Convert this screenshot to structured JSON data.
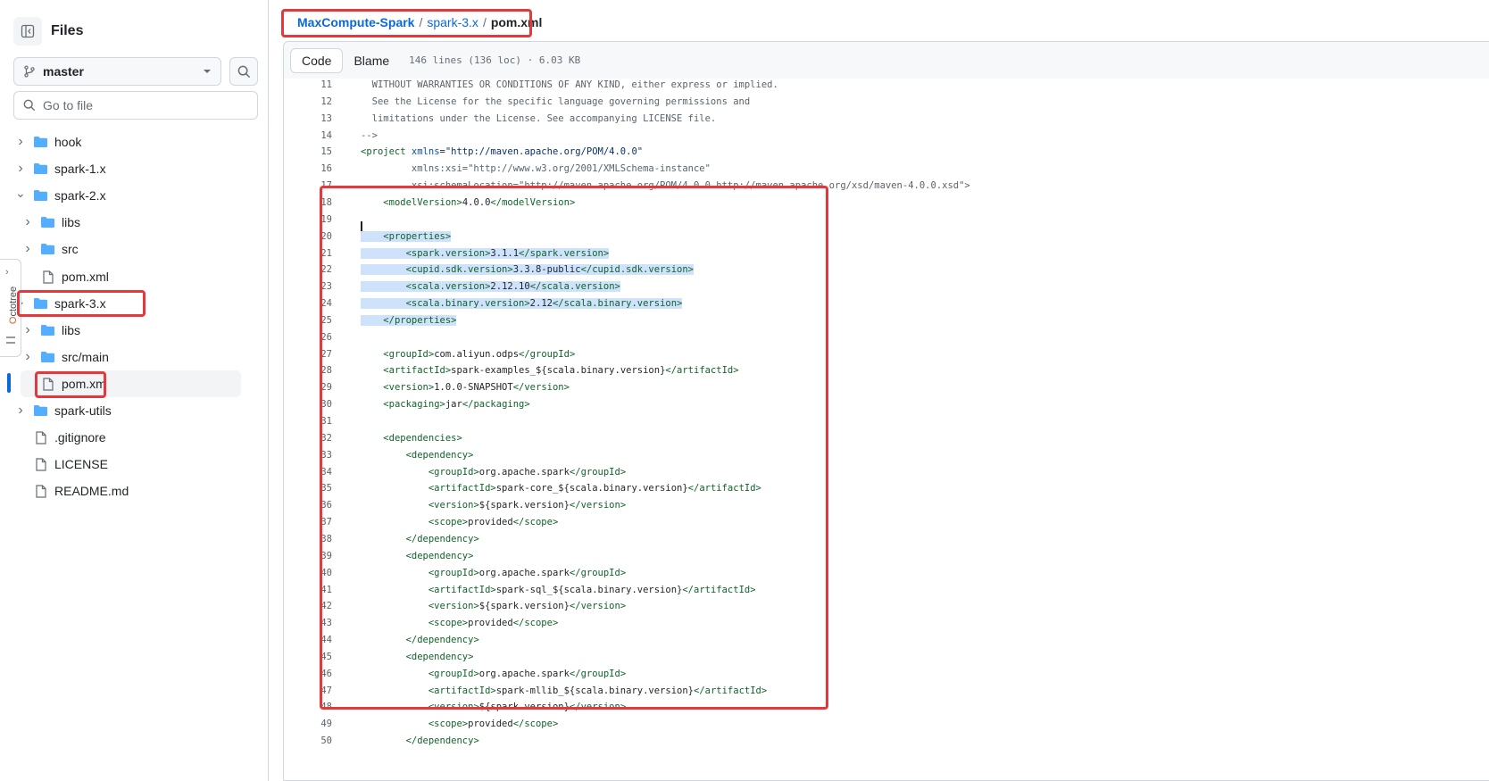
{
  "sidebar": {
    "title": "Files",
    "branch": "master",
    "goto_placeholder": "Go to file",
    "octotree_label": "Octotree",
    "tree": [
      {
        "name": "hook",
        "type": "folder",
        "chevron": "›",
        "depth": 0
      },
      {
        "name": "spark-1.x",
        "type": "folder",
        "chevron": "›",
        "depth": 0
      },
      {
        "name": "spark-2.x",
        "type": "folder",
        "chevron": "⌄",
        "depth": 0
      },
      {
        "name": "libs",
        "type": "folder",
        "chevron": "›",
        "depth": 1
      },
      {
        "name": "src",
        "type": "folder",
        "chevron": "›",
        "depth": 1
      },
      {
        "name": "pom.xml",
        "type": "file",
        "chevron": "",
        "depth": 1
      },
      {
        "name": "spark-3.x",
        "type": "folder",
        "chevron": "⌄",
        "depth": 0
      },
      {
        "name": "libs",
        "type": "folder",
        "chevron": "›",
        "depth": 1
      },
      {
        "name": "src/main",
        "type": "folder",
        "chevron": "›",
        "depth": 1
      },
      {
        "name": "pom.xm",
        "type": "file",
        "chevron": "",
        "depth": 1,
        "selected": true
      },
      {
        "name": "spark-utils",
        "type": "folder",
        "chevron": "›",
        "depth": 0
      },
      {
        "name": ".gitignore",
        "type": "file",
        "chevron": "",
        "depth": 0
      },
      {
        "name": "LICENSE",
        "type": "file",
        "chevron": "",
        "depth": 0
      },
      {
        "name": "README.md",
        "type": "file",
        "chevron": "",
        "depth": 0
      }
    ]
  },
  "breadcrumb": {
    "repo": "MaxCompute-Spark",
    "sep1": "/",
    "folder": "spark-3.x",
    "sep2": "/",
    "file": "pom.xml"
  },
  "file_header": {
    "tab_code": "Code",
    "tab_blame": "Blame",
    "meta": "146 lines (136 loc) · 6.03 KB"
  },
  "code": {
    "lines": [
      {
        "n": "11",
        "t": "  WITHOUT WARRANTIES OR CONDITIONS OF ANY KIND, either express or implied."
      },
      {
        "n": "12",
        "t": "  See the License for the specific language governing permissions and"
      },
      {
        "n": "13",
        "t": "  limitations under the License. See accompanying LICENSE file."
      },
      {
        "n": "14",
        "t": "-->"
      },
      {
        "n": "15",
        "t": "<project xmlns=\"http://maven.apache.org/POM/4.0.0\""
      },
      {
        "n": "16",
        "t": "         xmlns:xsi=\"http://www.w3.org/2001/XMLSchema-instance\""
      },
      {
        "n": "17",
        "t": "         xsi:schemaLocation=\"http://maven.apache.org/POM/4.0.0 http://maven.apache.org/xsd/maven-4.0.0.xsd\">"
      },
      {
        "n": "18",
        "t": "    <modelVersion>4.0.0</modelVersion>"
      },
      {
        "n": "19",
        "t": ""
      },
      {
        "n": "20",
        "t": "    <properties>",
        "sel": true
      },
      {
        "n": "21",
        "t": "        <spark.version>3.1.1</spark.version>",
        "sel": true
      },
      {
        "n": "22",
        "t": "        <cupid.sdk.version>3.3.8-public</cupid.sdk.version>",
        "sel": true
      },
      {
        "n": "23",
        "t": "        <scala.version>2.12.10</scala.version>",
        "sel": true
      },
      {
        "n": "24",
        "t": "        <scala.binary.version>2.12</scala.binary.version>",
        "sel": true
      },
      {
        "n": "25",
        "t": "    </properties>",
        "sel": true
      },
      {
        "n": "26",
        "t": ""
      },
      {
        "n": "27",
        "t": "    <groupId>com.aliyun.odps</groupId>"
      },
      {
        "n": "28",
        "t": "    <artifactId>spark-examples_${scala.binary.version}</artifactId>"
      },
      {
        "n": "29",
        "t": "    <version>1.0.0-SNAPSHOT</version>"
      },
      {
        "n": "30",
        "t": "    <packaging>jar</packaging>"
      },
      {
        "n": "31",
        "t": ""
      },
      {
        "n": "32",
        "t": "    <dependencies>"
      },
      {
        "n": "33",
        "t": "        <dependency>"
      },
      {
        "n": "34",
        "t": "            <groupId>org.apache.spark</groupId>"
      },
      {
        "n": "35",
        "t": "            <artifactId>spark-core_${scala.binary.version}</artifactId>"
      },
      {
        "n": "36",
        "t": "            <version>${spark.version}</version>"
      },
      {
        "n": "37",
        "t": "            <scope>provided</scope>"
      },
      {
        "n": "38",
        "t": "        </dependency>"
      },
      {
        "n": "39",
        "t": "        <dependency>"
      },
      {
        "n": "40",
        "t": "            <groupId>org.apache.spark</groupId>"
      },
      {
        "n": "41",
        "t": "            <artifactId>spark-sql_${scala.binary.version}</artifactId>"
      },
      {
        "n": "42",
        "t": "            <version>${spark.version}</version>"
      },
      {
        "n": "43",
        "t": "            <scope>provided</scope>"
      },
      {
        "n": "44",
        "t": "        </dependency>"
      },
      {
        "n": "45",
        "t": "        <dependency>"
      },
      {
        "n": "46",
        "t": "            <groupId>org.apache.spark</groupId>"
      },
      {
        "n": "47",
        "t": "            <artifactId>spark-mllib_${scala.binary.version}</artifactId>"
      },
      {
        "n": "48",
        "t": "            <version>${spark.version}</version>"
      },
      {
        "n": "49",
        "t": "            <scope>provided</scope>"
      },
      {
        "n": "50",
        "t": "        </dependency>"
      }
    ]
  },
  "colors": {
    "accent": "#0969da",
    "annotation": "#e4393c",
    "selection": "#cfe2fb",
    "xml_tag": "#116329",
    "xml_attr": "#0550ae",
    "xml_string": "#0a3069"
  }
}
